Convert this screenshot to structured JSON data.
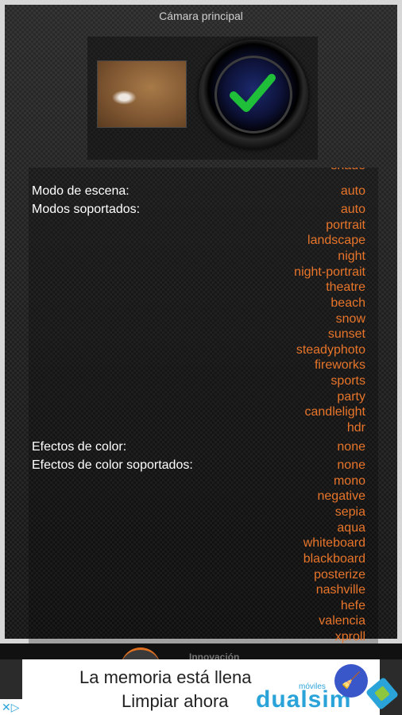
{
  "header": {
    "title": "Cámara principal"
  },
  "list": {
    "cut_value": "shade",
    "scene_mode": {
      "label": "Modo de escena:",
      "value": "auto"
    },
    "supported_modes": {
      "label": "Modos soportados:",
      "values": [
        "auto",
        "portrait",
        "landscape",
        "night",
        "night-portrait",
        "theatre",
        "beach",
        "snow",
        "sunset",
        "steadyphoto",
        "fireworks",
        "sports",
        "party",
        "candlelight",
        "hdr"
      ]
    },
    "color_effect": {
      "label": "Efectos de color:",
      "value": "none"
    },
    "supported_effects": {
      "label": "Efectos de color soportados:",
      "values": [
        "none",
        "mono",
        "negative",
        "sepia",
        "aqua",
        "whiteboard",
        "blackboard",
        "posterize",
        "nashville",
        "hefe",
        "valencia",
        "xproll"
      ]
    }
  },
  "ad": {
    "top_brand": "Innovación",
    "line1": "La memoria está llena",
    "line2": "Limpiar ahora",
    "brand": "dualsim",
    "brand_sub": "móviles",
    "adchoices": "✕▷"
  },
  "colors": {
    "value": "#e8752a",
    "label": "#ffffff",
    "brand": "#2aa3d9"
  }
}
